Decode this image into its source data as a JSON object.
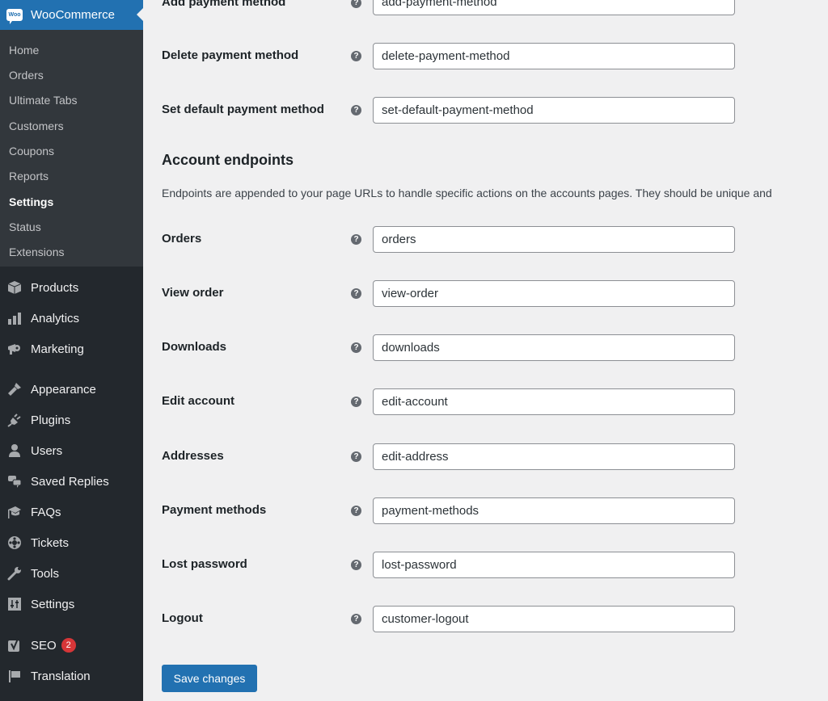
{
  "sidebar": {
    "woocommerce": {
      "label": "WooCommerce",
      "logo_text": "Woo"
    },
    "submenu": [
      {
        "label": "Home",
        "current": false
      },
      {
        "label": "Orders",
        "current": false
      },
      {
        "label": "Ultimate Tabs",
        "current": false
      },
      {
        "label": "Customers",
        "current": false
      },
      {
        "label": "Coupons",
        "current": false
      },
      {
        "label": "Reports",
        "current": false
      },
      {
        "label": "Settings",
        "current": true
      },
      {
        "label": "Status",
        "current": false
      },
      {
        "label": "Extensions",
        "current": false
      }
    ],
    "menu": [
      {
        "label": "Products",
        "icon": "box-icon"
      },
      {
        "label": "Analytics",
        "icon": "bar-chart-icon"
      },
      {
        "label": "Marketing",
        "icon": "megaphone-icon"
      },
      {
        "label": "Appearance",
        "icon": "paintbrush-icon"
      },
      {
        "label": "Plugins",
        "icon": "plug-icon"
      },
      {
        "label": "Users",
        "icon": "user-icon"
      },
      {
        "label": "Saved Replies",
        "icon": "chat-bubbles-icon"
      },
      {
        "label": "FAQs",
        "icon": "graduation-cap-icon"
      },
      {
        "label": "Tickets",
        "icon": "lifebuoy-icon"
      },
      {
        "label": "Tools",
        "icon": "wrench-icon"
      },
      {
        "label": "Settings",
        "icon": "sliders-icon"
      },
      {
        "label": "SEO",
        "icon": "yoast-icon",
        "badge": "2"
      },
      {
        "label": "Translation",
        "icon": "flag-icon"
      }
    ]
  },
  "main": {
    "top_fields": [
      {
        "label": "Add payment method",
        "value": "add-payment-method"
      },
      {
        "label": "Delete payment method",
        "value": "delete-payment-method"
      },
      {
        "label": "Set default payment method",
        "value": "set-default-payment-method"
      }
    ],
    "section": {
      "title": "Account endpoints",
      "description": "Endpoints are appended to your page URLs to handle specific actions on the accounts pages. They should be unique and"
    },
    "account_fields": [
      {
        "label": "Orders",
        "value": "orders"
      },
      {
        "label": "View order",
        "value": "view-order"
      },
      {
        "label": "Downloads",
        "value": "downloads"
      },
      {
        "label": "Edit account",
        "value": "edit-account"
      },
      {
        "label": "Addresses",
        "value": "edit-address"
      },
      {
        "label": "Payment methods",
        "value": "payment-methods"
      },
      {
        "label": "Lost password",
        "value": "lost-password"
      },
      {
        "label": "Logout",
        "value": "customer-logout"
      }
    ],
    "help_glyph": "?",
    "save_label": "Save changes"
  }
}
